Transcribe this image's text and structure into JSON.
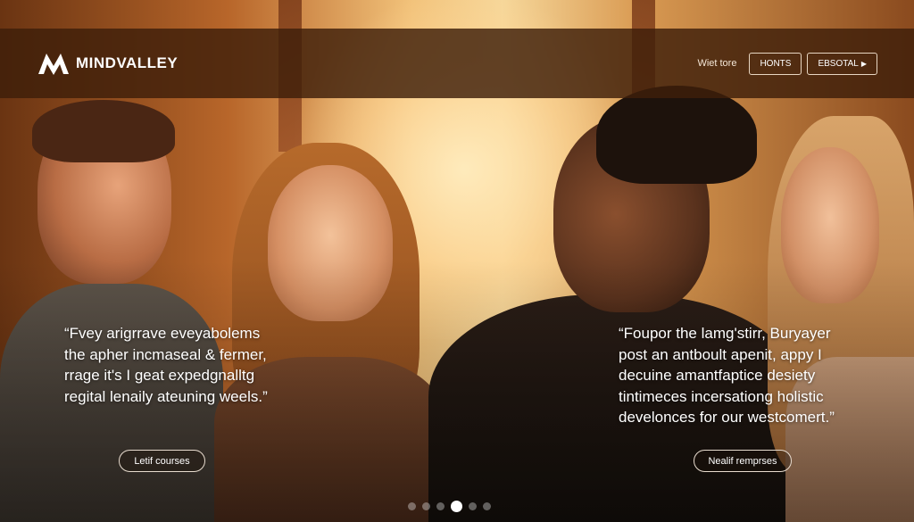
{
  "header": {
    "logo_text": "MINDVALLEY",
    "nav_link": "Wiet tore",
    "button_1": "HONTS",
    "button_2": "EBSOTAL"
  },
  "quotes": {
    "left": {
      "lines": [
        "“Fvey arigrrave eveyabolems",
        "the apher incmaseal & fermer,",
        "rrage it's I geat expedgnalltg",
        "regital lenaily ateuning weels.”"
      ],
      "button": "Letif courses"
    },
    "right": {
      "lines": [
        "“Foupor the lamg'stirr, Buryayer",
        "post an antboult apenit, appy I",
        "decuine amantfaptice desiety",
        "tintimeces incersationg holistic",
        "develonces for our westcomert.”"
      ],
      "button": "Nealif remprses"
    }
  },
  "carousel": {
    "total": 6,
    "active_index": 3
  },
  "colors": {
    "header_bg": "#3e1e0a",
    "accent_warm": "#f2c27a",
    "text": "#ffffff"
  },
  "icons": {
    "logo": "mindvalley-logo-icon",
    "caret": "caret-right-icon"
  }
}
